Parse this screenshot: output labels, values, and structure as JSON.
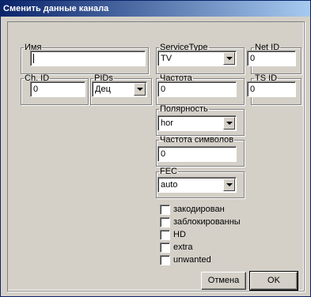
{
  "window": {
    "title": "Сменить данные канала"
  },
  "groups": {
    "name": {
      "label": "Имя",
      "value": ""
    },
    "service_type": {
      "label": "ServiceType",
      "value": "TV"
    },
    "net_id": {
      "label": "Net ID",
      "value": "0"
    },
    "ch_id": {
      "label": "Ch. ID",
      "value": "0"
    },
    "pids": {
      "label": "PIDs",
      "value": "Дец"
    },
    "frequency": {
      "label": "Частота",
      "value": "0"
    },
    "ts_id": {
      "label": "TS ID",
      "value": "0"
    },
    "polarity": {
      "label": "Полярность",
      "value": "hor"
    },
    "symbol_rate": {
      "label": "Частота символов",
      "value": "0"
    },
    "fec": {
      "label": "FEC",
      "value": "auto"
    }
  },
  "checkboxes": [
    {
      "label": "закодирован",
      "checked": false
    },
    {
      "label": "заблокированны",
      "checked": false
    },
    {
      "label": "HD",
      "checked": false
    },
    {
      "label": "extra",
      "checked": false
    },
    {
      "label": "unwanted",
      "checked": false
    }
  ],
  "buttons": {
    "cancel": "Отмена",
    "ok": "OK"
  },
  "icons": {
    "dropdown": "chevron-down-icon"
  },
  "colors": {
    "titlebar_start": "#0a246a",
    "titlebar_end": "#a6caf0",
    "face": "#d4d0c8"
  }
}
